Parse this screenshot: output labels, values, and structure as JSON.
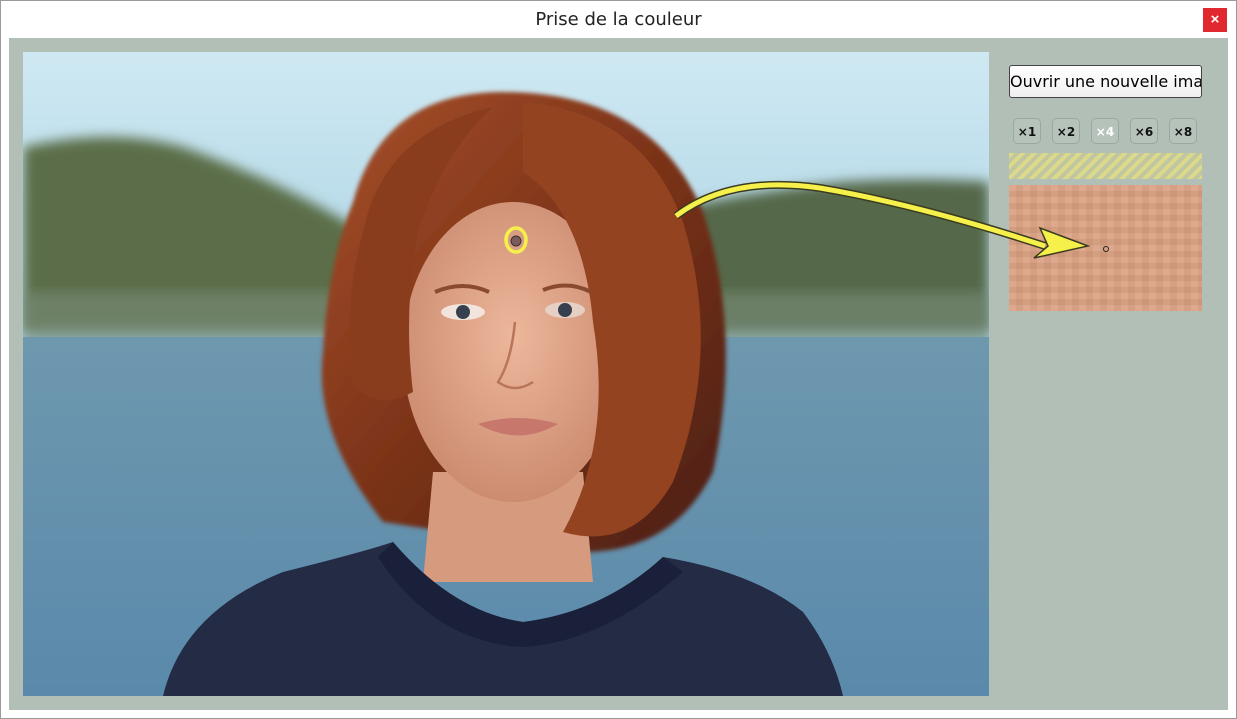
{
  "window": {
    "title": "Prise de la couleur",
    "close_label": "×"
  },
  "sidebar": {
    "open_button_label": "Ouvrir une nouvelle image",
    "zoom_buttons": [
      {
        "label": "×1",
        "active": false
      },
      {
        "label": "×2",
        "active": false
      },
      {
        "label": "×4",
        "active": true
      },
      {
        "label": "×6",
        "active": false
      },
      {
        "label": "×8",
        "active": false
      }
    ],
    "picked_color": "#daa080"
  },
  "photo": {
    "subject": "portrait-photo",
    "picker_marker": "eyedropper-circle"
  },
  "colors": {
    "client_bg": "#b1bfb6",
    "close_bg": "#e0282e",
    "annotation_yellow": "#f5f04a"
  }
}
